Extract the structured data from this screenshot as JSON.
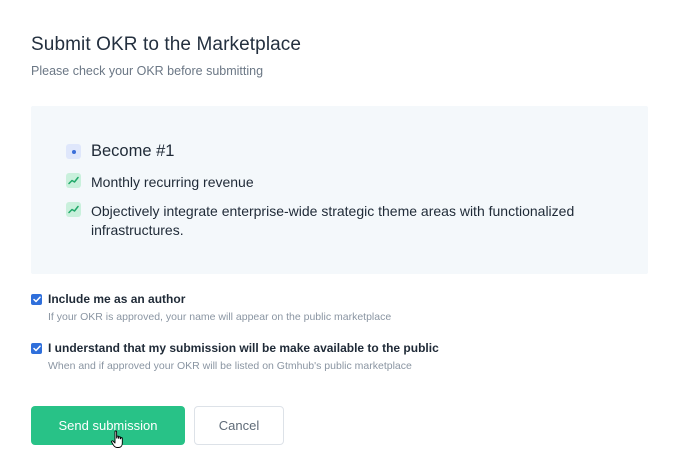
{
  "dialog": {
    "title": "Submit OKR to the Marketplace",
    "subtitle": "Please check your OKR before submitting"
  },
  "okr": {
    "objective": {
      "icon": "goal-dot-icon",
      "text": "Become #1"
    },
    "key_results": [
      {
        "icon": "trend-line-icon",
        "text": "Monthly recurring revenue"
      },
      {
        "icon": "trend-line-icon",
        "text": "Objectively integrate enterprise-wide strategic theme areas with functionalized infrastructures."
      }
    ]
  },
  "options": [
    {
      "checked": true,
      "label": "Include me as an author",
      "help": "If your OKR is approved, your name will appear on the public marketplace"
    },
    {
      "checked": true,
      "label": "I understand that my submission will be make available to the public",
      "help": "When and if approved your OKR will be listed on Gtmhub's public marketplace"
    }
  ],
  "actions": {
    "submit_label": "Send submission",
    "cancel_label": "Cancel"
  },
  "colors": {
    "primary": "#28c287",
    "checkbox": "#2f6fdb",
    "panel_bg": "#f4f8fb"
  }
}
